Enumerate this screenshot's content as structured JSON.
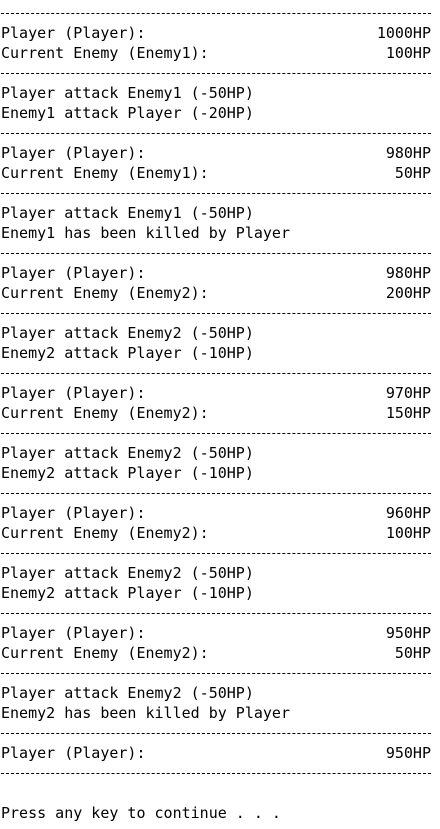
{
  "window": {
    "prompt": "Press any key to continue . . ."
  },
  "blocks": [
    {
      "kind": "status",
      "rows": [
        {
          "label": "Player (Player):",
          "value": "1000HP"
        },
        {
          "label": "Current Enemy (Enemy1):",
          "value": "100HP"
        }
      ]
    },
    {
      "kind": "log",
      "lines": [
        "Player attack Enemy1 (-50HP)",
        "Enemy1 attack Player (-20HP)"
      ]
    },
    {
      "kind": "status",
      "rows": [
        {
          "label": "Player (Player):",
          "value": "980HP"
        },
        {
          "label": "Current Enemy (Enemy1):",
          "value": "50HP"
        }
      ]
    },
    {
      "kind": "log",
      "lines": [
        "Player attack Enemy1 (-50HP)",
        "Enemy1 has been killed by Player"
      ]
    },
    {
      "kind": "status",
      "rows": [
        {
          "label": "Player (Player):",
          "value": "980HP"
        },
        {
          "label": "Current Enemy (Enemy2):",
          "value": "200HP"
        }
      ]
    },
    {
      "kind": "log",
      "lines": [
        "Player attack Enemy2 (-50HP)",
        "Enemy2 attack Player (-10HP)"
      ]
    },
    {
      "kind": "status",
      "rows": [
        {
          "label": "Player (Player):",
          "value": "970HP"
        },
        {
          "label": "Current Enemy (Enemy2):",
          "value": "150HP"
        }
      ]
    },
    {
      "kind": "log",
      "lines": [
        "Player attack Enemy2 (-50HP)",
        "Enemy2 attack Player (-10HP)"
      ]
    },
    {
      "kind": "status",
      "rows": [
        {
          "label": "Player (Player):",
          "value": "960HP"
        },
        {
          "label": "Current Enemy (Enemy2):",
          "value": "100HP"
        }
      ]
    },
    {
      "kind": "log",
      "lines": [
        "Player attack Enemy2 (-50HP)",
        "Enemy2 attack Player (-10HP)"
      ]
    },
    {
      "kind": "status",
      "rows": [
        {
          "label": "Player (Player):",
          "value": "950HP"
        },
        {
          "label": "Current Enemy (Enemy2):",
          "value": "50HP"
        }
      ]
    },
    {
      "kind": "log",
      "lines": [
        "Player attack Enemy2 (-50HP)",
        "Enemy2 has been killed by Player"
      ]
    },
    {
      "kind": "status",
      "rows": [
        {
          "label": "Player (Player):",
          "value": "950HP"
        }
      ]
    }
  ]
}
